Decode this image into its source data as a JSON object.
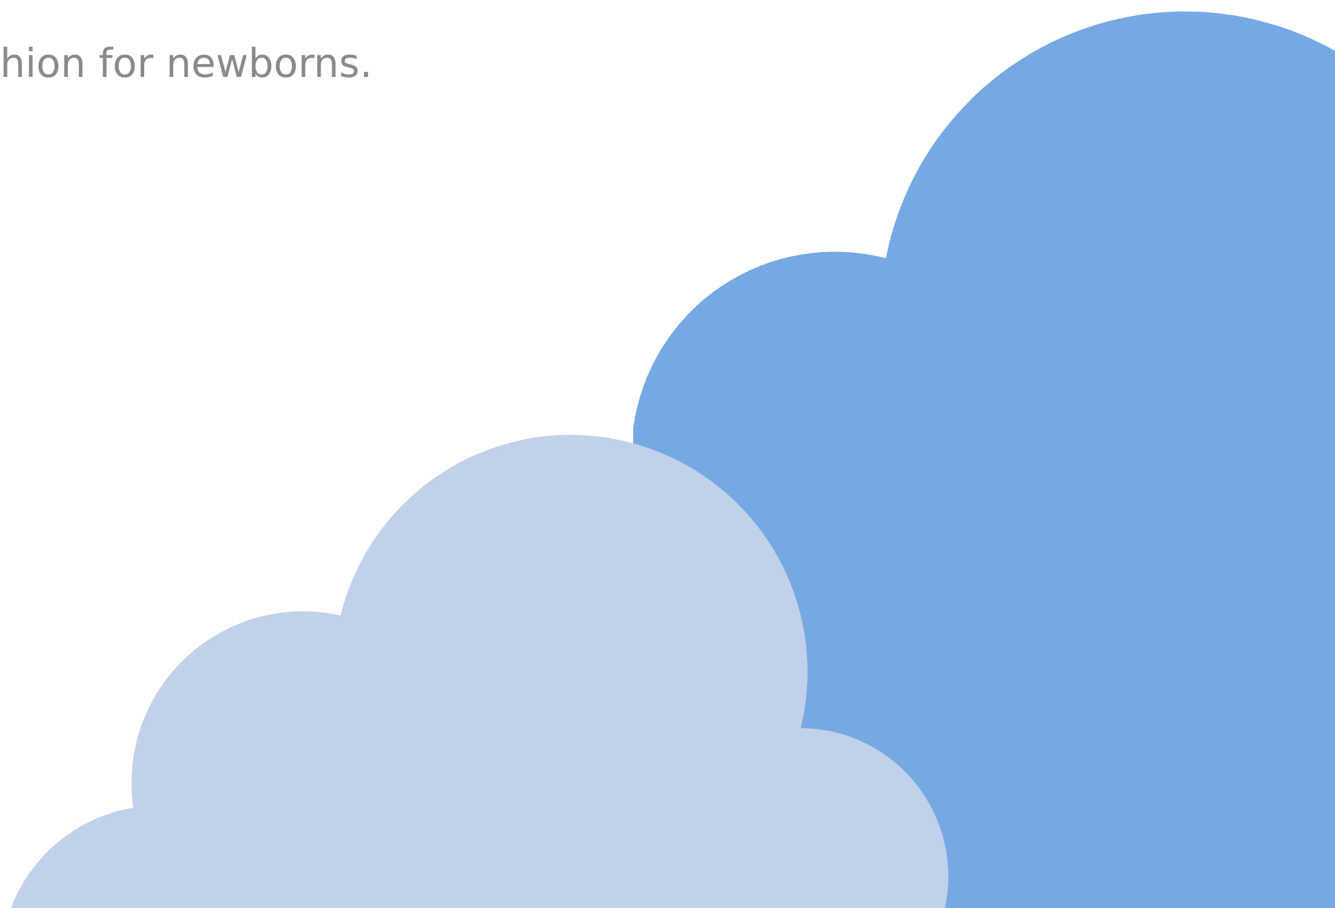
{
  "intro": {
    "text": "hion for newborns."
  }
}
